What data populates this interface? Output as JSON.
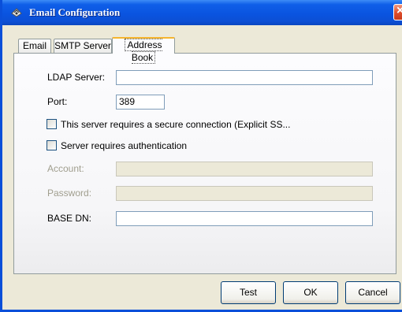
{
  "window": {
    "title": "Email Configuration"
  },
  "tabs": [
    {
      "label": "Email"
    },
    {
      "label": "SMTP Server"
    },
    {
      "label": "Address Book",
      "active": true
    }
  ],
  "form": {
    "ldap_server": {
      "label": "LDAP Server:",
      "value": ""
    },
    "port": {
      "label": "Port:",
      "value": "389"
    },
    "secure_connection": {
      "label": "This server requires a secure connection (Explicit SS...",
      "checked": false
    },
    "requires_auth": {
      "label": "Server requires authentication",
      "checked": false
    },
    "account": {
      "label": "Account:",
      "value": "",
      "disabled": true
    },
    "password": {
      "label": "Password:",
      "value": "",
      "disabled": true
    },
    "base_dn": {
      "label": "BASE DN:",
      "value": ""
    }
  },
  "buttons": {
    "test": "Test",
    "ok": "OK",
    "cancel": "Cancel"
  },
  "colors": {
    "titlebar": "#0a54e0",
    "dialog_bg": "#ece9d8",
    "active_tab_accent": "#f6b52f"
  }
}
